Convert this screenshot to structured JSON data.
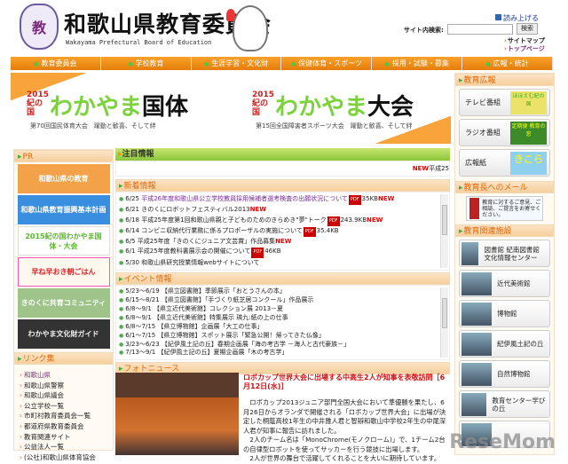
{
  "header": {
    "emblem": "教",
    "title": "和歌山県教育委員会",
    "subtitle": "Wakayama Prefectural Board of Education",
    "read_aloud": "読み上げる",
    "search_label": "サイト内検索:",
    "search_value": "",
    "search_button": "検索",
    "sitemap": "サイトマップ",
    "top_page": "トップページ"
  },
  "nav": [
    "教育委員会",
    "学校教育",
    "生涯学習・文化財",
    "保健体育・スポーツ",
    "採用・試験・募集",
    "広報・統計"
  ],
  "banner": {
    "year": "2015 紀の国",
    "left_title": "わかやま",
    "left_suffix": "国体",
    "left_sub": "第70回国民体育大会　躍動と歓喜、そして絆",
    "right_title": "わかやま",
    "right_suffix": "大会",
    "right_sub": "第15回全国障害者スポーツ大会　躍動と歓喜、そして絆"
  },
  "left": {
    "pr_title": "PR",
    "pr_items": [
      "和歌山県の教育",
      "和歌山県教育振興基本計画",
      "2015紀の国わかやま国体・大会",
      "早ね早おき朝ごはん",
      "きのくに共育コミュニティ",
      "わかやま文化財ガイド"
    ],
    "links_title": "リンク集",
    "links": [
      "和歌山県",
      "和歌山県警察",
      "和歌山県議会",
      "公立学校一覧",
      "市町村教育委員会一覧",
      "都道府県教育委員会",
      "教育関連サイト",
      "公益法人一覧",
      "(公社)和歌山県体育協会"
    ]
  },
  "center": {
    "featured_title": "注目情報",
    "featured_ticker_new": "NEW",
    "featured_ticker": "平成25",
    "news_title": "新着情報",
    "news": [
      {
        "date": "6/25",
        "text": "平成26年度和歌山県公立学校教員採用候補者選考検査の出願状況について",
        "pdf": "PDF",
        "size": "35KB",
        "new": "NEW"
      },
      {
        "date": "6/21",
        "text": "きのくにロボットフェスティバル2013",
        "pdf": "",
        "size": "",
        "new": "NEW"
      },
      {
        "date": "6/18",
        "text": "平成25年度第1回和歌山県親と子どものためのきらめき\"夢\"トーク",
        "pdf": "PDF",
        "size": "243.9KB",
        "new": "NEW"
      },
      {
        "date": "6/14",
        "text": "コンビニ収納代行業務に係るプロポーザルの実施について",
        "pdf": "PDF",
        "size": "35.4KB",
        "new": ""
      },
      {
        "date": "6/5",
        "text": "平成25年度「きのくにジュニア文芸賞」作品募集",
        "pdf": "",
        "size": "",
        "new": "NEW"
      },
      {
        "date": "6/1",
        "text": "平成25年度教科書展示会の開催について",
        "pdf": "PDF",
        "size": "46KB",
        "new": ""
      },
      {
        "date": "5/30",
        "text": "和歌山県研究授業情報webサイトについて",
        "pdf": "",
        "size": "",
        "new": ""
      }
    ],
    "events_title": "イベント情報",
    "events": [
      "5/23～6/19 【県立図書館】季節展示「おとうさんの本」",
      "6/15～8/21 【県立図書館】「手づくり紙芝居コンクール」作品展示",
      "6/8～9/1 【県立近代美術館】コレクション展 2013－夏",
      "6/8～9/1 【県立近代美術館】特集展示 瑛九:紙の上の仕事",
      "6/8～7/15 【県立博物館】企画展「大工の仕事」",
      "6/1～7/15 【県立博物館】スポット展示「緊急公開！帰ってきた仏像」",
      "3/23～6/23 【紀伊風土記の丘】春期企画展「海の考古学 －海人と古代豪族－」",
      "7/13～9/1 【紀伊風土記の丘】夏期企画展「木の考古学」"
    ],
    "photo_title": "フォトニュース",
    "photo_headline": "ロボカップ世界大会に出場する中高生2人が知事を表敬訪問［6月12日(水)］",
    "photo_body": [
      "ロボカップ2013ジュニア部門全国大会において準優勝を果たし、6月26日からオランダで開催される「ロボカップ世界大会」に出場が決定した桐蔭高校1年生の中井雅人君と智辯和歌山中学校2年生の中尾深人君が知事に報告に訪れました。",
      "2人のチーム名は「MonoChrome(モノクローム)」で、1チーム2台の自律型ロボットを使ってサッカーを行う競技に出場します。",
      "2人が世界の舞台で活躍してくれることを大いに期待しています。"
    ]
  },
  "right": {
    "pr_title": "教育広報",
    "pr_buttons": [
      "テレビ番組",
      "ラジオ番組",
      "広報紙"
    ],
    "pr_thumbs": [
      "ほほえむ紀の国",
      "定期便 教育の窓",
      "きこら"
    ],
    "mail_title": "教育長へのメール",
    "mail_text": "教育に対するご意見、ご相談、ご提言をお寄せください。",
    "facilities_title": "教育関連施設",
    "facilities": [
      "図書館 紀南図書館 文化情報センター",
      "近代美術館",
      "博物館",
      "紀伊風土記の丘",
      "自然博物館",
      "教育センター学びの丘",
      ""
    ]
  },
  "watermark": "ReseMom"
}
